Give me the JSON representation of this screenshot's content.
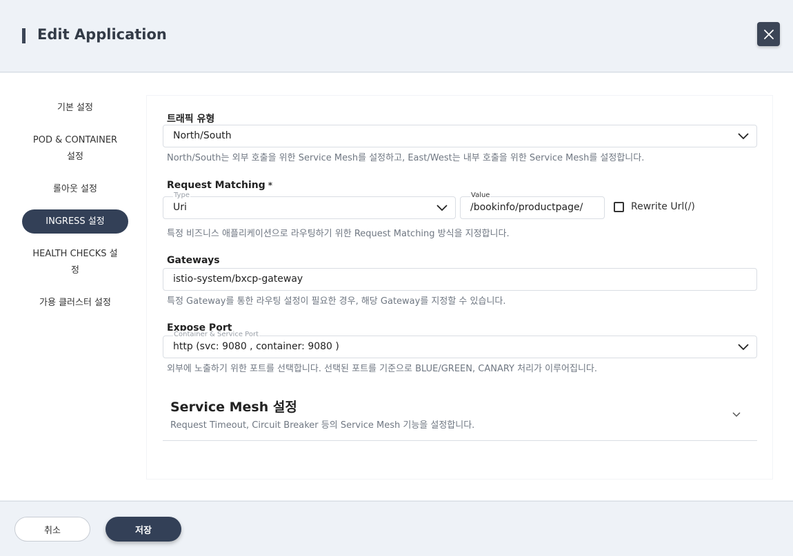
{
  "header": {
    "title": "Edit Application"
  },
  "sidebar": {
    "items": [
      {
        "label": "기본 설정"
      },
      {
        "label": "POD & CONTAINER 설정"
      },
      {
        "label": "롤아웃 설정"
      },
      {
        "label": "INGRESS 설정",
        "active": true
      },
      {
        "label": "HEALTH CHECKS 설정"
      },
      {
        "label": "가용 클러스터 설정"
      }
    ]
  },
  "form": {
    "traffic": {
      "label": "트래픽 유형",
      "value": "North/South",
      "help": "North/South는 외부 호출을 위한 Service Mesh를 설정하고, East/West는 내부 호출을 위한 Service Mesh를 설정합니다."
    },
    "request_matching": {
      "label": "Request Matching",
      "required_mark": "*",
      "type_label": "Type",
      "type_value": "Uri",
      "value_label": "Value",
      "value": "/bookinfo/productpage/",
      "rewrite_label": "Rewrite Url(/)",
      "help": "특정 비즈니스 애플리케이션으로 라우팅하기 위한 Request Matching 방식을 지정합니다."
    },
    "gateways": {
      "label": "Gateways",
      "value": "istio-system/bxcp-gateway",
      "help": "특정 Gateway를 통한 라우팅 설정이 필요한 경우, 해당 Gateway를 지정할 수 있습니다."
    },
    "expose_port": {
      "label": "Expose Port",
      "float_label": "Container & Service Port",
      "value": "http (svc: 9080 , container: 9080 )",
      "help": "외부에 노출하기 위한 포트를 선택합니다. 선택된 포트를 기준으로 BLUE/GREEN, CANARY 처리가 이루어집니다."
    },
    "service_mesh": {
      "title": "Service Mesh 설정",
      "subtitle": "Request Timeout, Circuit Breaker 등의 Service Mesh 기능을 설정합니다."
    }
  },
  "footer": {
    "cancel_label": "취소",
    "save_label": "저장"
  },
  "colors": {
    "accent": "#334057",
    "background": "#eef2f7"
  }
}
